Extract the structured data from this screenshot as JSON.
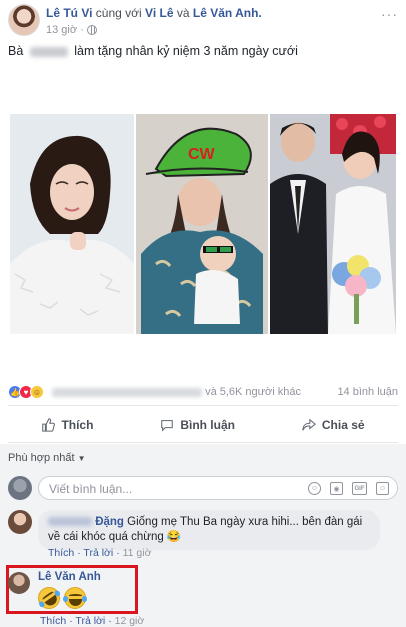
{
  "post": {
    "author": "Lê Tú Vi",
    "with_text": "cùng với",
    "tagged_1": "Vi Lê",
    "and_text": "và",
    "tagged_2": "Lê Văn Anh.",
    "time": "13 giờ",
    "text_prefix": "Bà",
    "text_suffix": "làm tặng nhân kỷ niệm 3 năm ngày cưới",
    "more": "···"
  },
  "photos": {
    "middle_hat_text": "CW"
  },
  "reactions": {
    "others": "và 5,6K người khác",
    "comments_count": "14 bình luận"
  },
  "actions": {
    "like": "Thích",
    "comment": "Bình luận",
    "share": "Chia sẻ"
  },
  "comments_section": {
    "sort": "Phù hợp nhất",
    "compose_placeholder": "Viết bình luận...",
    "comment1": {
      "name_visible": "Đặng",
      "text": "Giống mẹ Thu Ba ngày xưa hihi... bên đàn gái về cái khóc quá chừng 😂",
      "like": "Thích",
      "reply": "Trả lời",
      "time": "11 giờ"
    },
    "comment2": {
      "name": "Lê Văn Anh",
      "emojis": "🤣😂",
      "like": "Thích",
      "reply": "Trả lời",
      "time": "12 giờ"
    }
  },
  "colors": {
    "link": "#365899",
    "highlight": "#d9151e",
    "like": "#4a7cf0",
    "love": "#f0284a",
    "haha": "#f7c83c"
  }
}
